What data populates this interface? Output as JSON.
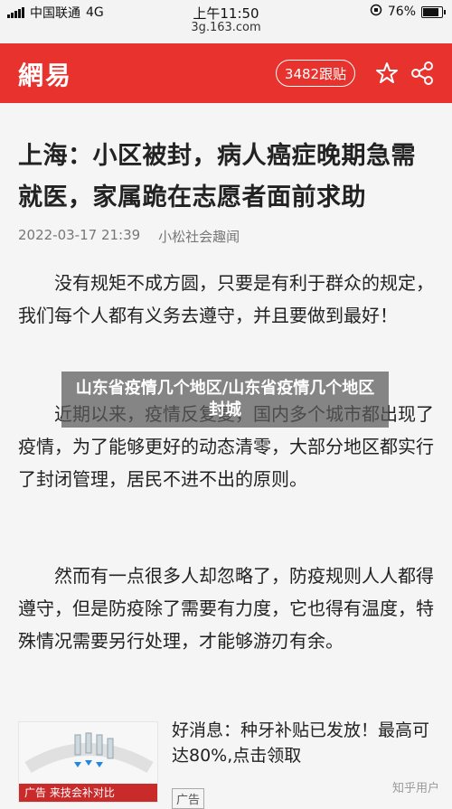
{
  "status_bar": {
    "carrier": "中国联通",
    "network": "4G",
    "time": "上午11:50",
    "url": "3g.163.com",
    "battery": "76%"
  },
  "header": {
    "logo": "網易",
    "follow_label": "3482跟贴",
    "icons": [
      "star-icon",
      "share-icon"
    ],
    "bg_color": "#e8322d"
  },
  "article": {
    "title": "上海：小区被封，病人癌症晚期急需就医，家属跪在志愿者面前求助",
    "date": "2022-03-17 21:39",
    "source": "小松社会趣闻",
    "paragraphs": [
      "没有规矩不成方圆，只要是有利于群众的规定，我们每个人都有义务去遵守，并且要做到最好！",
      "近期以来，疫情反复复，国内多个城市都出现了疫情，为了能够更好的动态清零，大部分地区都实行了封闭管理，居民不进不出的原则。",
      "然而有一点很多人却忽略了，防疫规则人人都得遵守，但是防疫除了需要有力度，它也得有温度，特殊情况需要另行处理，才能够游刃有余。"
    ]
  },
  "watermark": {
    "text": "山东省疫情几个地区/山东省疫情几个地区封城"
  },
  "ad": {
    "banner": "广告 来技会补对比",
    "text": "好消息：种牙补贴已发放！最高可达80%,点击领取",
    "badge": "广告"
  },
  "source_mark": "知乎用户"
}
